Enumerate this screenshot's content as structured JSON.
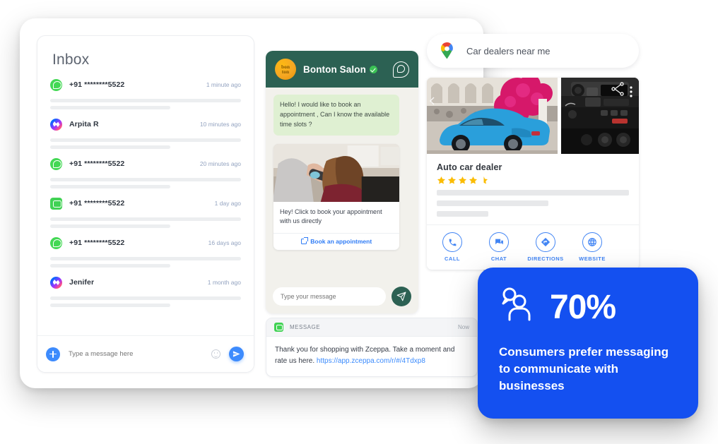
{
  "inbox": {
    "title": "Inbox",
    "conversations": [
      {
        "channel": "whatsapp",
        "name": "+91 ********5522",
        "time": "1 minute ago"
      },
      {
        "channel": "messenger",
        "name": "Arpita R",
        "time": "10 minutes ago"
      },
      {
        "channel": "whatsapp",
        "name": "+91 ********5522",
        "time": "20 minutes ago"
      },
      {
        "channel": "sms",
        "name": "+91 ********5522",
        "time": "1 day ago"
      },
      {
        "channel": "whatsapp",
        "name": "+91 ********5522",
        "time": "16 days ago"
      },
      {
        "channel": "messenger",
        "name": "Jenifer",
        "time": "1 month ago"
      }
    ],
    "compose": {
      "placeholder": "Type a message here",
      "add_icon": "plus-icon",
      "emoji_icon": "emoji-icon",
      "send_icon": "send-icon"
    }
  },
  "chat": {
    "header": {
      "logo_line1": "bon",
      "logo_line2": "ton",
      "title": "Bonton Salon",
      "verified_icon": "verified-badge-icon",
      "channel_icon": "whatsapp-icon"
    },
    "incoming_message": "Hello! I would like to book an appointment , Can I know the available time slots ?",
    "card": {
      "text": "Hey! Click to book your appointment with us directly",
      "cta_label": "Book an appointment",
      "cta_icon": "external-link-icon"
    },
    "compose": {
      "placeholder": "Type your message",
      "send_icon": "send-icon"
    }
  },
  "sms": {
    "icon": "messages-app-icon",
    "label": "MESSAGE",
    "time": "Now",
    "body_text": "Thank you for shopping with Zceppa. Take a moment and rate us here. ",
    "link": "https://app.zceppa.com/r/#/4Tdxp8"
  },
  "maps": {
    "search": {
      "icon": "google-maps-pin-icon",
      "value": "Car dealers near me"
    },
    "business": {
      "name": "Auto car dealer",
      "rating": 4.5,
      "stars_full": 4,
      "stars_half": 1,
      "actions": [
        {
          "label": "CALL",
          "icon": "phone-icon"
        },
        {
          "label": "CHAT",
          "icon": "chat-icon"
        },
        {
          "label": "DIRECTIONS",
          "icon": "directions-icon"
        },
        {
          "label": "WEBSITE",
          "icon": "globe-icon"
        }
      ]
    }
  },
  "stat_card": {
    "icon": "person-with-message-icon",
    "percentage": "70%",
    "caption": "Consumers prefer messaging to communicate with businesses",
    "background_color": "#1450f0"
  },
  "colors": {
    "whatsapp_green": "#43d854",
    "chat_header_green": "#2c6153",
    "bubble_green": "#dff0d2",
    "accent_blue": "#3d8bfd",
    "maps_blue": "#4285f4",
    "star_yellow": "#fbbc04",
    "stat_blue": "#1450f0"
  }
}
